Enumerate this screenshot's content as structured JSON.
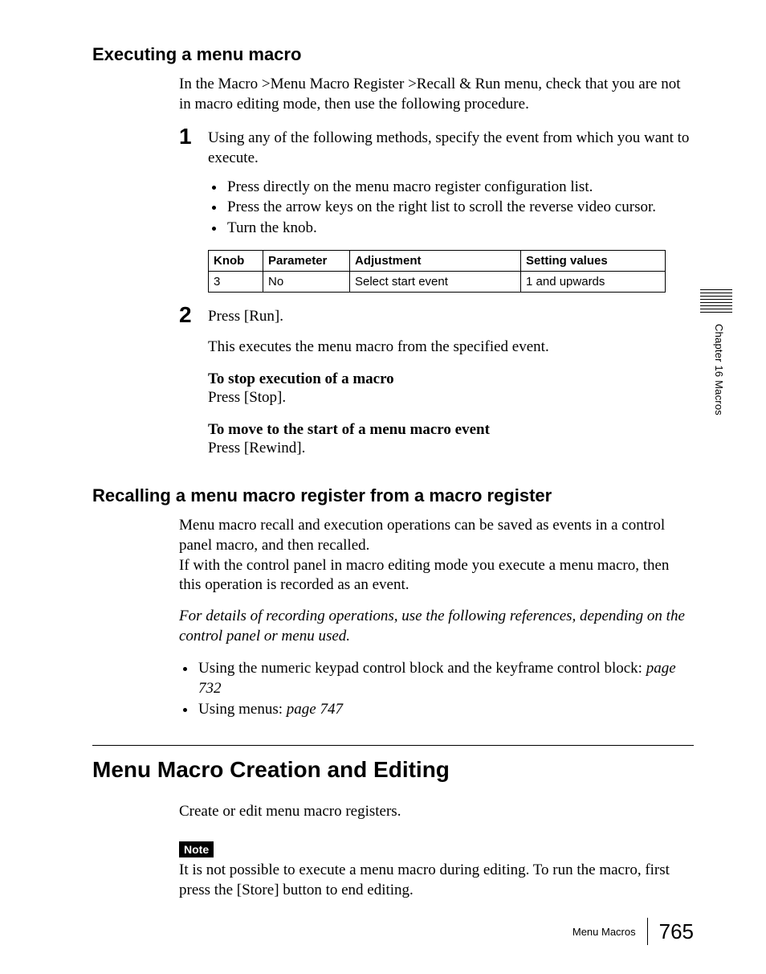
{
  "section1": {
    "title": "Executing a menu macro",
    "intro": "In the Macro >Menu Macro Register >Recall & Run menu, check that you are not in macro editing mode, then use the following procedure.",
    "step1_num": "1",
    "step1_text": "Using any of the following methods, specify the event from which you want to execute.",
    "step1_bullets": [
      "Press directly on the menu macro register configuration list.",
      "Press the arrow keys on the right list to scroll the reverse video cursor.",
      "Turn the knob."
    ],
    "table": {
      "headers": [
        "Knob",
        "Parameter",
        "Adjustment",
        "Setting values"
      ],
      "row": [
        "3",
        "No",
        "Select start event",
        "1 and upwards"
      ]
    },
    "step2_num": "2",
    "step2_text": "Press [Run].",
    "step2_after": "This executes the menu macro from the specified event.",
    "stop_h": "To stop execution of a macro",
    "stop_t": "Press [Stop].",
    "move_h": "To move to the start of a menu macro event",
    "move_t": "Press [Rewind]."
  },
  "section2": {
    "title": "Recalling a menu macro register from a macro register",
    "p1": "Menu macro recall and execution operations can be saved as events in a control panel macro, and then recalled.",
    "p2": "If with the control panel in macro editing mode you execute a menu macro, then this operation is recorded as an event.",
    "italic": "For details of recording operations, use the following references, depending on the control panel or menu used.",
    "b1_pre": "Using the numeric keypad control block and the keyframe control block: ",
    "b1_ref": "page 732",
    "b2_pre": "Using menus: ",
    "b2_ref": "page 747"
  },
  "section3": {
    "title": "Menu Macro Creation and Editing",
    "p1": "Create or edit menu macro registers.",
    "note_label": "Note",
    "note_text": "It is not possible to execute a menu macro during editing. To run the macro, first press the [Store] button to end editing."
  },
  "sidebar": "Chapter 16  Macros",
  "footer": {
    "title": "Menu Macros",
    "page": "765"
  }
}
